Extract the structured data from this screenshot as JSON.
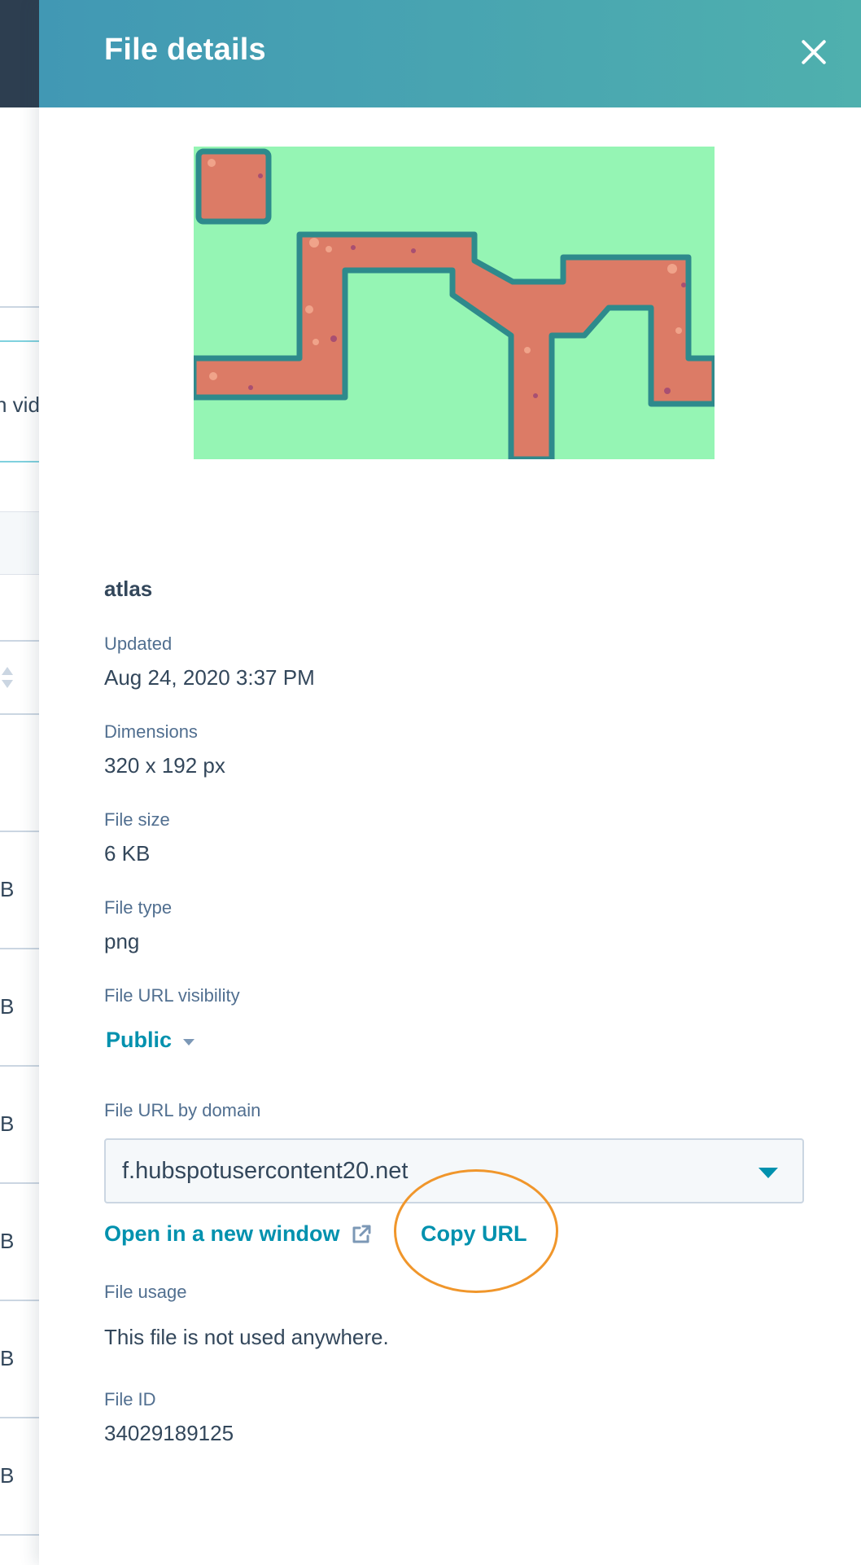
{
  "background": {
    "fragments": [
      "n vid",
      "B",
      "B",
      "B",
      "B",
      "B",
      "B"
    ]
  },
  "panel": {
    "title": "File details",
    "close_icon": "close-icon"
  },
  "file": {
    "name": "atlas",
    "updated_label": "Updated",
    "updated_value": "Aug 24, 2020 3:37 PM",
    "dimensions_label": "Dimensions",
    "dimensions_value": "320 x 192 px",
    "size_label": "File size",
    "size_value": "6 KB",
    "type_label": "File type",
    "type_value": "png",
    "visibility_label": "File URL visibility",
    "visibility_value": "Public",
    "domain_label": "File URL by domain",
    "domain_value": "f.hubspotusercontent20.net",
    "open_link": "Open in a new window",
    "copy_url": "Copy URL",
    "usage_label": "File usage",
    "usage_value": "This file is not used anywhere.",
    "id_label": "File ID",
    "id_value": "34029189125"
  },
  "colors": {
    "header_start": "#4198b4",
    "header_end": "#4fb0ae",
    "link": "#0091ae",
    "highlight": "#f0962b",
    "preview_grass": "#95f5b4",
    "preview_path": "#dc7b66"
  }
}
